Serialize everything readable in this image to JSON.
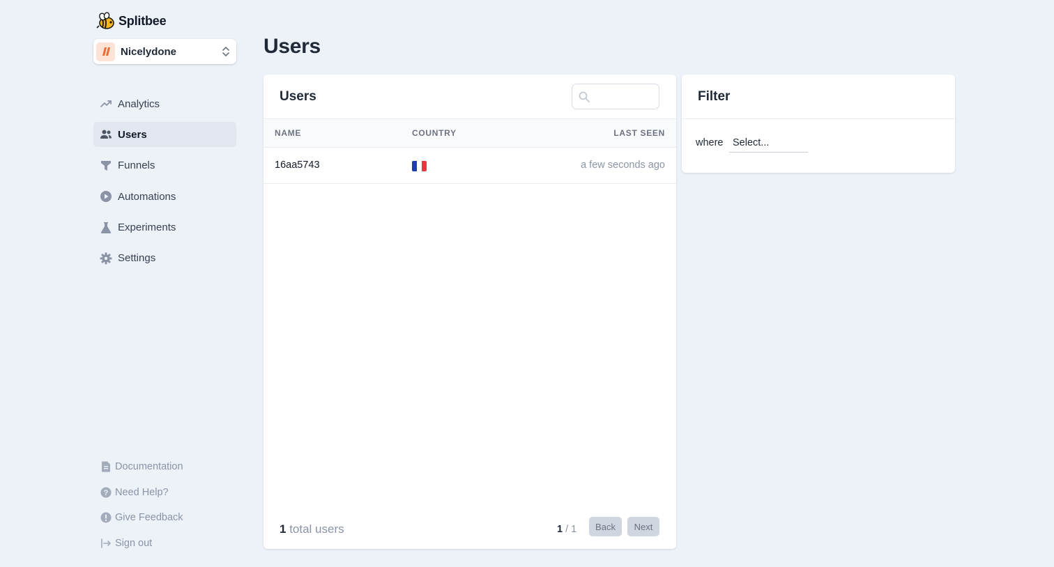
{
  "brand": {
    "name": "Splitbee"
  },
  "site_selector": {
    "name": "Nicelydone"
  },
  "nav": [
    {
      "label": "Analytics",
      "icon": "trending-up-icon"
    },
    {
      "label": "Users",
      "icon": "users-icon",
      "active": true
    },
    {
      "label": "Funnels",
      "icon": "funnel-icon"
    },
    {
      "label": "Automations",
      "icon": "play-circle-icon"
    },
    {
      "label": "Experiments",
      "icon": "beaker-icon"
    },
    {
      "label": "Settings",
      "icon": "gear-icon"
    }
  ],
  "bottom_nav": [
    {
      "label": "Documentation",
      "icon": "document-icon"
    },
    {
      "label": "Need Help?",
      "icon": "question-circle-icon"
    },
    {
      "label": "Give Feedback",
      "icon": "exclamation-circle-icon"
    },
    {
      "label": "Sign out",
      "icon": "sign-out-icon"
    }
  ],
  "page": {
    "title": "Users"
  },
  "users_card": {
    "title": "Users",
    "search_placeholder": "",
    "columns": [
      "Name",
      "Country",
      "Last seen"
    ],
    "rows": [
      {
        "name": "16aa5743",
        "country": "France",
        "flag_colors": [
          "#1f3fa6",
          "#ffffff",
          "#ef3340"
        ],
        "last_seen": "a few seconds ago"
      }
    ],
    "total_count": "1",
    "total_label": "total users",
    "page_current": "1",
    "page_sep": " / ",
    "page_total": "1",
    "back_label": "Back",
    "next_label": "Next"
  },
  "filter_card": {
    "title": "Filter",
    "where_label": "where",
    "select_placeholder": "Select..."
  },
  "colors": {
    "background": "#edf1f8",
    "active_nav": "#e2e7ef",
    "muted_text": "#8a94a6",
    "button_disabled": "#cfd6e0"
  }
}
